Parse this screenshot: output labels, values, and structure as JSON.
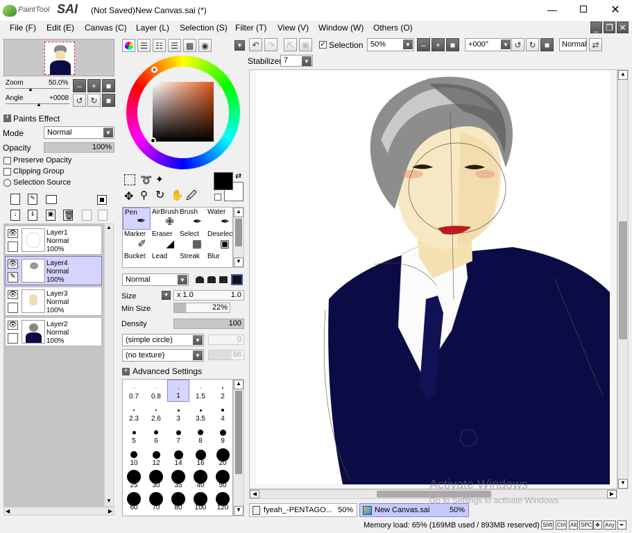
{
  "app": {
    "logo_text": "PaintTool",
    "logo_brand": "SAI",
    "window_title": "(Not Saved)New Canvas.sai (*)"
  },
  "menu": [
    "File (F)",
    "Edit (E)",
    "Canvas (C)",
    "Layer (L)",
    "Selection (S)",
    "Filter (T)",
    "View (V)",
    "Window (W)",
    "Others (O)"
  ],
  "navigator": {
    "zoom_label": "Zoom",
    "zoom_value": "50.0%",
    "angle_label": "Angle",
    "angle_value": "+0008"
  },
  "paint_effect": {
    "header": "Paints Effect",
    "mode_label": "Mode",
    "mode_value": "Normal",
    "opacity_label": "Opacity",
    "opacity_value": "100%",
    "preserve_opacity": "Preserve Opacity",
    "clipping_group": "Clipping Group",
    "selection_source": "Selection Source"
  },
  "layers": [
    {
      "name": "Layer1",
      "mode": "Normal",
      "opacity": "100%",
      "selected": false
    },
    {
      "name": "Layer4",
      "mode": "Normal",
      "opacity": "100%",
      "selected": true
    },
    {
      "name": "Layer3",
      "mode": "Normal",
      "opacity": "100%",
      "selected": false
    },
    {
      "name": "Layer2",
      "mode": "Normal",
      "opacity": "100%",
      "selected": false
    }
  ],
  "tools": [
    {
      "name": "Pen",
      "icon": "pen-icon"
    },
    {
      "name": "AirBrush",
      "icon": "airbrush-icon"
    },
    {
      "name": "Brush",
      "icon": "brush-icon"
    },
    {
      "name": "Water",
      "icon": "water-icon"
    },
    {
      "name": "Marker",
      "icon": "marker-icon"
    },
    {
      "name": "Eraser",
      "icon": "eraser-icon"
    },
    {
      "name": "Select",
      "icon": "select-icon"
    },
    {
      "name": "Deselect",
      "icon": "deselect-icon"
    },
    {
      "name": "Bucket",
      "icon": "bucket-icon"
    },
    {
      "name": "Lead",
      "icon": "lead-icon"
    },
    {
      "name": "Streak",
      "icon": "streak-icon"
    },
    {
      "name": "Blur",
      "icon": "blur-icon"
    }
  ],
  "brush": {
    "blend_mode": "Normal",
    "size_label": "Size",
    "size_multiplier": "x 1.0",
    "size_value": "1.0",
    "min_size_label": "Min Size",
    "min_size_value": "22%",
    "density_label": "Density",
    "density_value": "100",
    "shape": "(simple circle)",
    "shape_value": "0",
    "texture": "(no texture)",
    "texture_value": "66",
    "advanced": "Advanced Settings"
  },
  "brush_sizes": [
    "0.7",
    "0.8",
    "1",
    "1.5",
    "2",
    "2.3",
    "2.6",
    "3",
    "3.5",
    "4",
    "5",
    "6",
    "7",
    "8",
    "9",
    "10",
    "12",
    "14",
    "16",
    "20",
    "25",
    "30",
    "35",
    "40",
    "50",
    "60",
    "70",
    "80",
    "100",
    "120"
  ],
  "toolbar": {
    "selection_label": "Selection",
    "zoom_value": "50%",
    "angle_value": "+000°",
    "blend_value": "Normal",
    "stabilizer_label": "Stabilizer",
    "stabilizer_value": "7"
  },
  "doc_tabs": [
    {
      "name": "fyeah_-PENTAGO...",
      "zoom": "50%",
      "active": false
    },
    {
      "name": "New Canvas.sai",
      "zoom": "50%",
      "active": true
    }
  ],
  "status": {
    "memory": "Memory load: 65% (169MB used / 893MB reserved)",
    "keys": [
      "Shft",
      "Ctrl",
      "Alt",
      "SPC",
      "Any"
    ]
  },
  "watermark": {
    "line1": "Activate Windows",
    "line2": "Go to Settings to activate Windows."
  },
  "colors": {
    "accent": "#d4d4ff",
    "suit": "#0b0c45",
    "lips": "#c0181e"
  }
}
